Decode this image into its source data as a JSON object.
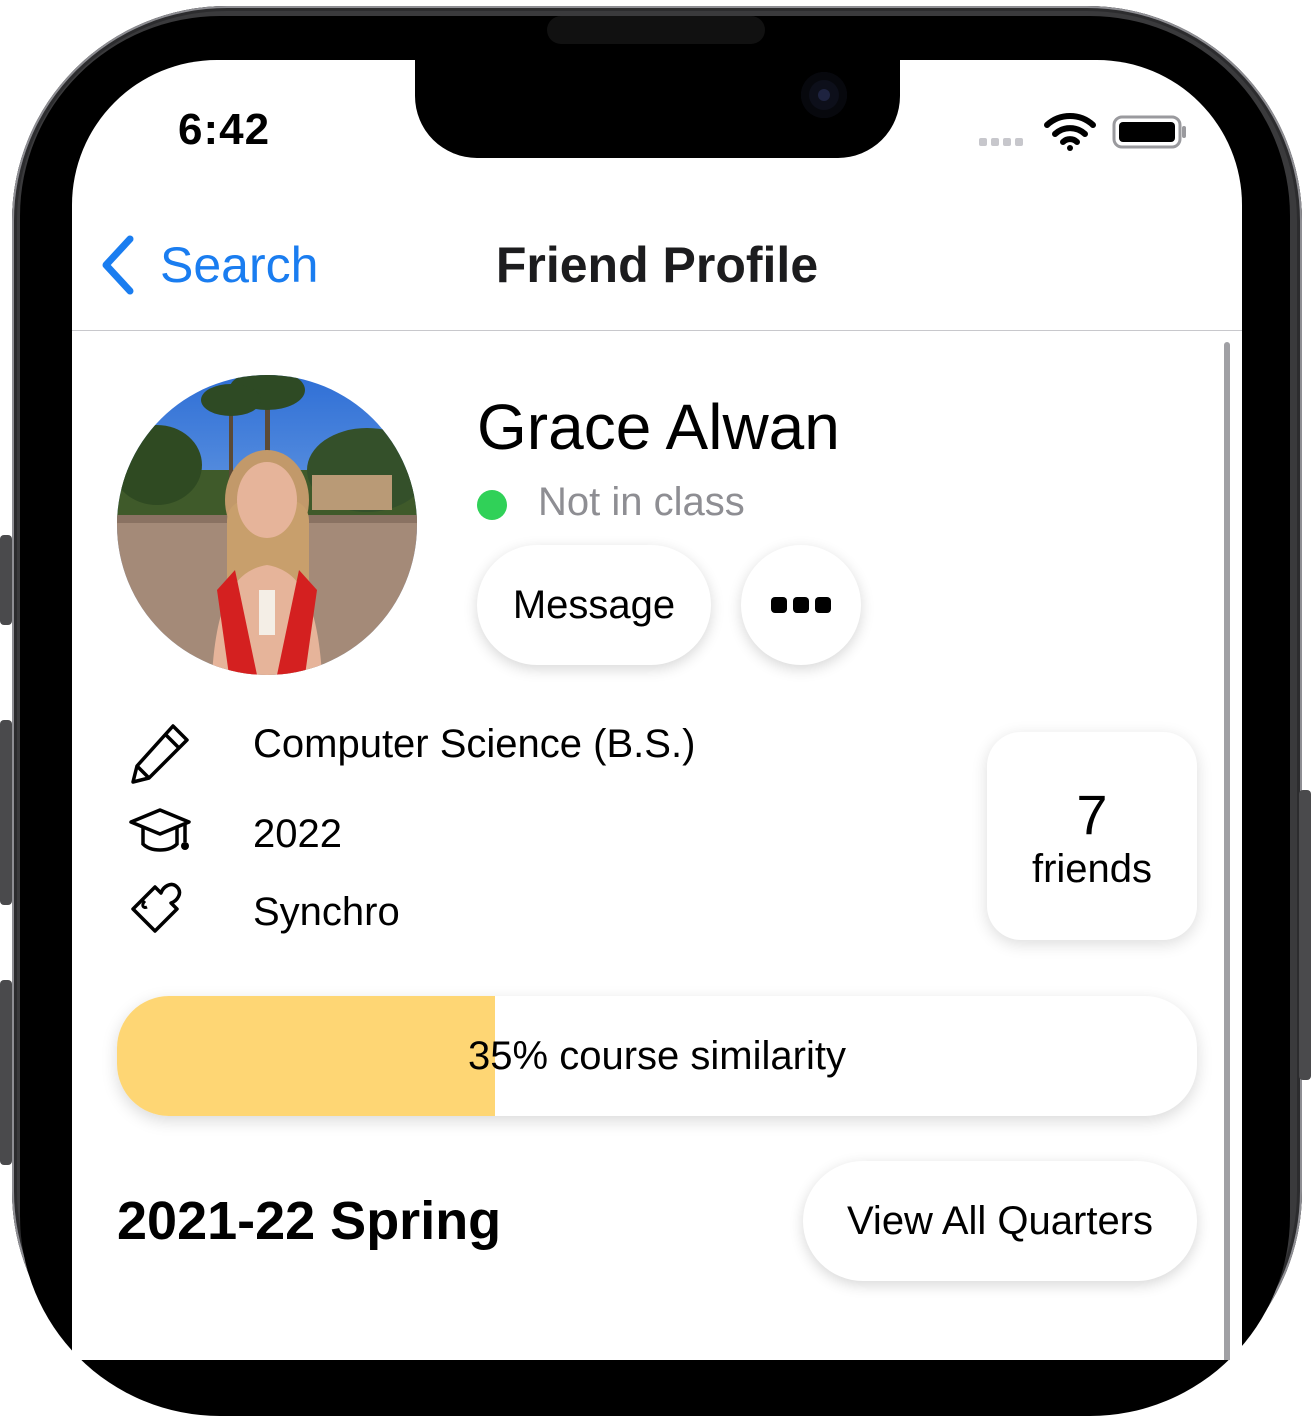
{
  "status_bar": {
    "time": "6:42"
  },
  "nav": {
    "back_label": "Search",
    "title": "Friend Profile"
  },
  "profile": {
    "name": "Grace Alwan",
    "status": "Not in class",
    "status_color": "#30d158",
    "message_label": "Message",
    "more_icon": "ellipsis-icon"
  },
  "info": [
    {
      "icon": "pencil-icon",
      "text": "Computer Science (B.S.)"
    },
    {
      "icon": "graduation-cap-icon",
      "text": "2022"
    },
    {
      "icon": "puzzle-icon",
      "text": "Synchro"
    }
  ],
  "friends": {
    "count": "7",
    "label": "friends"
  },
  "similarity": {
    "percent": 35,
    "text": "35% course similarity",
    "fill_color": "#fed674"
  },
  "quarter": {
    "title": "2021-22 Spring",
    "view_all_label": "View All Quarters"
  },
  "colors": {
    "accent": "#1a7df0"
  }
}
